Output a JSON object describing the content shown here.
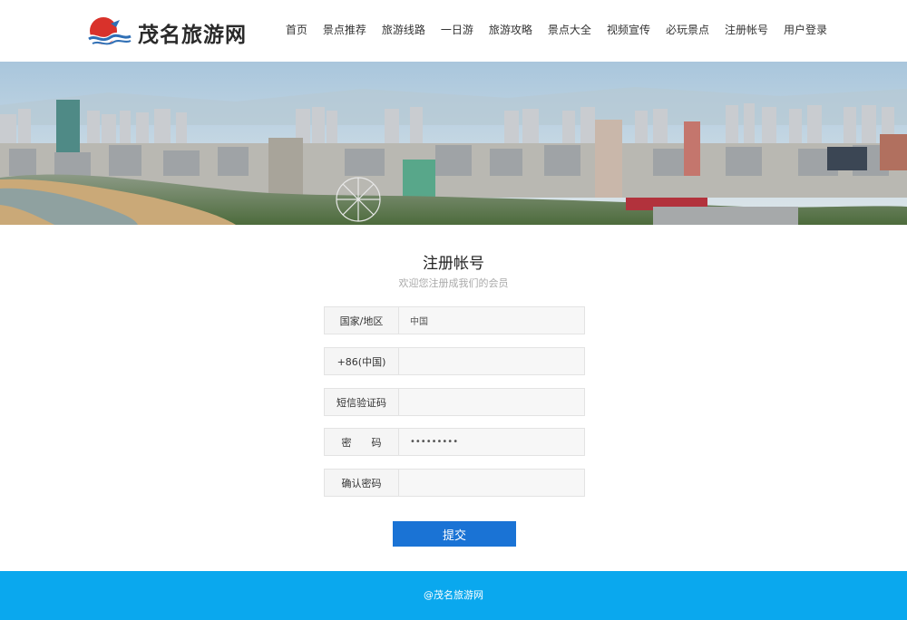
{
  "site": {
    "logo_text": "茂名旅游网",
    "logo_icon": "sunrise-wave-logo"
  },
  "nav": {
    "items": [
      "首页",
      "景点推荐",
      "旅游线路",
      "一日游",
      "旅游攻略",
      "景点大全",
      "视频宣传",
      "必玩景点",
      "注册帐号",
      "用户登录"
    ]
  },
  "banner": {
    "image": "city-skyline-panorama"
  },
  "form": {
    "title": "注册帐号",
    "subtitle": "欢迎您注册成我们的会员",
    "fields": [
      {
        "label": "国家/地区",
        "value": "中国",
        "type": "text"
      },
      {
        "label": "+86(中国)",
        "value": "",
        "type": "text"
      },
      {
        "label": "短信验证码",
        "value": "",
        "type": "text"
      },
      {
        "label": "密　　码",
        "value": "•••••••••",
        "type": "password"
      },
      {
        "label": "确认密码",
        "value": "",
        "type": "password"
      }
    ],
    "submit_label": "提交"
  },
  "footer": {
    "text": "@茂名旅游网"
  },
  "colors": {
    "accent": "#1a73d5",
    "footer_bg": "#0aa8ee",
    "logo_red": "#d9322b",
    "logo_blue": "#2f6fb5"
  }
}
